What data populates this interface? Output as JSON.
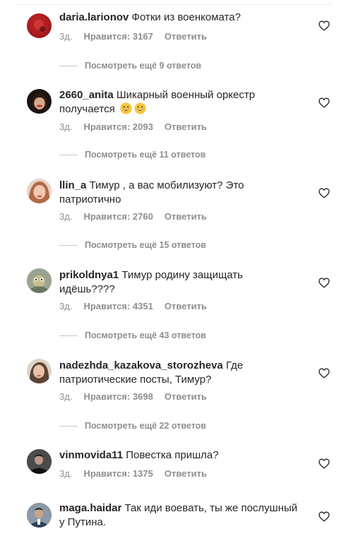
{
  "comments": [
    {
      "username": "daria.larionov",
      "text": "Фотки из военкомата?",
      "time": "3д.",
      "likes": "Нравится: 3167",
      "reply": "Ответить",
      "more": "Посмотреть ещё 9 ответов"
    },
    {
      "username": "2660_anita",
      "text": "Шикарный военный оркестр получается",
      "time": "3д.",
      "likes": "Нравится: 2093",
      "reply": "Ответить",
      "more": "Посмотреть ещё 11 ответов"
    },
    {
      "username": "llin_a",
      "text": "Тимур , а вас мобилизуют? Это патриотично",
      "time": "3д.",
      "likes": "Нравится: 2760",
      "reply": "Ответить",
      "more": "Посмотреть ещё 15 ответов"
    },
    {
      "username": "prikoldnya1",
      "text": "Тимур родину защищать идёшь????",
      "time": "3д.",
      "likes": "Нравится: 4351",
      "reply": "Ответить",
      "more": "Посмотреть ещё 43 ответов"
    },
    {
      "username": "nadezhda_kazakova_storozheva",
      "text": "Где патриотические посты, Тимур?",
      "time": "3д.",
      "likes": "Нравится: 3698",
      "reply": "Ответить",
      "more": "Посмотреть ещё 22 ответов"
    },
    {
      "username": "vinmovida11",
      "text": "Повестка пришла?",
      "time": "3д.",
      "likes": "Нравится: 1375",
      "reply": "Ответить"
    },
    {
      "username": "maga.haidar",
      "text": "Так иди воевать, ты же послушный у Путина."
    }
  ],
  "colors": {
    "text": "#262626",
    "secondary": "#8e8e8e",
    "heart": "#262626"
  },
  "icons": {
    "like": "heart-outline-icon",
    "emoji": "grinning-face-emoji"
  }
}
